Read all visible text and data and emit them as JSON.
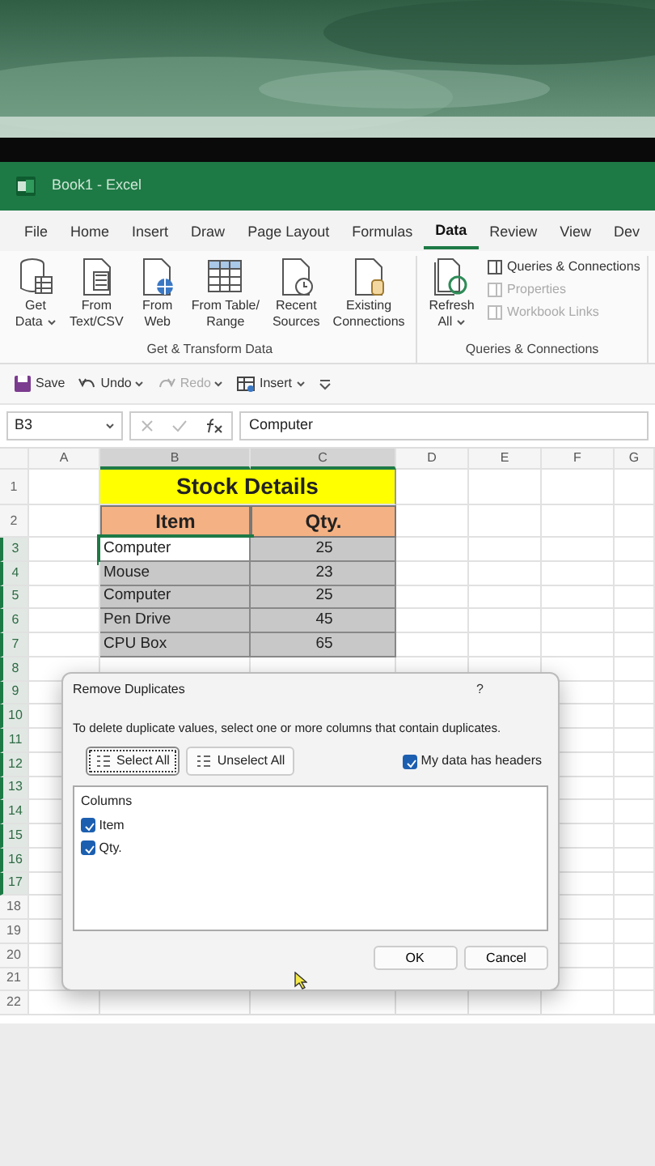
{
  "window": {
    "title": "Book1 - Excel"
  },
  "tabs": [
    {
      "label": "File",
      "selected": false
    },
    {
      "label": "Home",
      "selected": false
    },
    {
      "label": "Insert",
      "selected": false
    },
    {
      "label": "Draw",
      "selected": false
    },
    {
      "label": "Page Layout",
      "selected": false
    },
    {
      "label": "Formulas",
      "selected": false
    },
    {
      "label": "Data",
      "selected": true
    },
    {
      "label": "Review",
      "selected": false
    },
    {
      "label": "View",
      "selected": false
    },
    {
      "label": "Dev",
      "selected": false
    }
  ],
  "ribbon": {
    "groups": [
      {
        "label": "Get & Transform Data",
        "buttons": [
          {
            "kind": "database",
            "lines": [
              "Get",
              "Data"
            ],
            "dropdown": true
          },
          {
            "kind": "textfile",
            "lines": [
              "From",
              "Text/CSV"
            ],
            "dropdown": false
          },
          {
            "kind": "web",
            "lines": [
              "From",
              "Web"
            ],
            "dropdown": false
          },
          {
            "kind": "table",
            "lines": [
              "From Table/",
              "Range"
            ],
            "dropdown": false
          },
          {
            "kind": "recent",
            "lines": [
              "Recent",
              "Sources"
            ],
            "dropdown": false
          },
          {
            "kind": "connections",
            "lines": [
              "Existing",
              "Connections"
            ],
            "dropdown": false
          }
        ]
      },
      {
        "label": "Queries & Connections",
        "buttons": [
          {
            "kind": "refresh",
            "lines": [
              "Refresh",
              "All"
            ],
            "dropdown": true
          }
        ],
        "small": [
          {
            "label": "Queries & Connections",
            "disabled": false
          },
          {
            "label": "Properties",
            "disabled": true
          },
          {
            "label": "Workbook Links",
            "disabled": true
          }
        ]
      }
    ]
  },
  "quick_access": [
    {
      "kind": "save",
      "label": "Save",
      "disabled": false,
      "dropdown": false
    },
    {
      "kind": "undo",
      "label": "Undo",
      "disabled": false,
      "dropdown": true
    },
    {
      "kind": "redo",
      "label": "Redo",
      "disabled": true,
      "dropdown": true
    },
    {
      "kind": "insert",
      "label": "Insert",
      "disabled": false,
      "dropdown": true
    }
  ],
  "formula_bar": {
    "name_box": "B3",
    "value": "Computer"
  },
  "columns": [
    {
      "label": "A",
      "selected": false
    },
    {
      "label": "B",
      "selected": true
    },
    {
      "label": "C",
      "selected": true
    },
    {
      "label": "D",
      "selected": false
    },
    {
      "label": "E",
      "selected": false
    },
    {
      "label": "F",
      "selected": false
    },
    {
      "label": "G",
      "selected": false
    }
  ],
  "row_numbers": [
    {
      "label": "1",
      "selected": false
    },
    {
      "label": "2",
      "selected": false
    },
    {
      "label": "3",
      "selected": true
    },
    {
      "label": "4",
      "selected": true
    },
    {
      "label": "5",
      "selected": true
    },
    {
      "label": "6",
      "selected": true
    },
    {
      "label": "7",
      "selected": true
    },
    {
      "label": "8",
      "selected": true
    },
    {
      "label": "9",
      "selected": true
    },
    {
      "label": "10",
      "selected": true
    },
    {
      "label": "11",
      "selected": true
    },
    {
      "label": "12",
      "selected": true
    },
    {
      "label": "13",
      "selected": true
    },
    {
      "label": "14",
      "selected": true
    },
    {
      "label": "15",
      "selected": true
    },
    {
      "label": "16",
      "selected": true
    },
    {
      "label": "17",
      "selected": true
    },
    {
      "label": "18",
      "selected": false
    },
    {
      "label": "19",
      "selected": false
    },
    {
      "label": "20",
      "selected": false
    },
    {
      "label": "21",
      "selected": false
    },
    {
      "label": "22",
      "selected": false
    }
  ],
  "sheet": {
    "title": "Stock Details",
    "headers": [
      "Item",
      "Qty."
    ],
    "rows": [
      {
        "item": "Computer",
        "qty": "25",
        "active": true
      },
      {
        "item": "Mouse",
        "qty": "23",
        "active": false
      },
      {
        "item": "Computer",
        "qty": "25",
        "active": false
      },
      {
        "item": "Pen Drive",
        "qty": "45",
        "active": false
      },
      {
        "item": "CPU Box",
        "qty": "65",
        "active": false
      }
    ]
  },
  "dialog": {
    "title": "Remove Duplicates",
    "help": "?",
    "instruction": "To delete duplicate values, select one or more columns that contain duplicates.",
    "buttons": [
      {
        "label": "Select All",
        "focused": true
      },
      {
        "label": "Unselect All",
        "focused": false
      }
    ],
    "headers_checkbox": {
      "label": "My data has headers",
      "checked": true
    },
    "columns_label": "Columns",
    "columns": [
      {
        "label": "Item",
        "checked": true
      },
      {
        "label": "Qty.",
        "checked": true
      }
    ],
    "ok": "OK",
    "cancel": "Cancel"
  }
}
